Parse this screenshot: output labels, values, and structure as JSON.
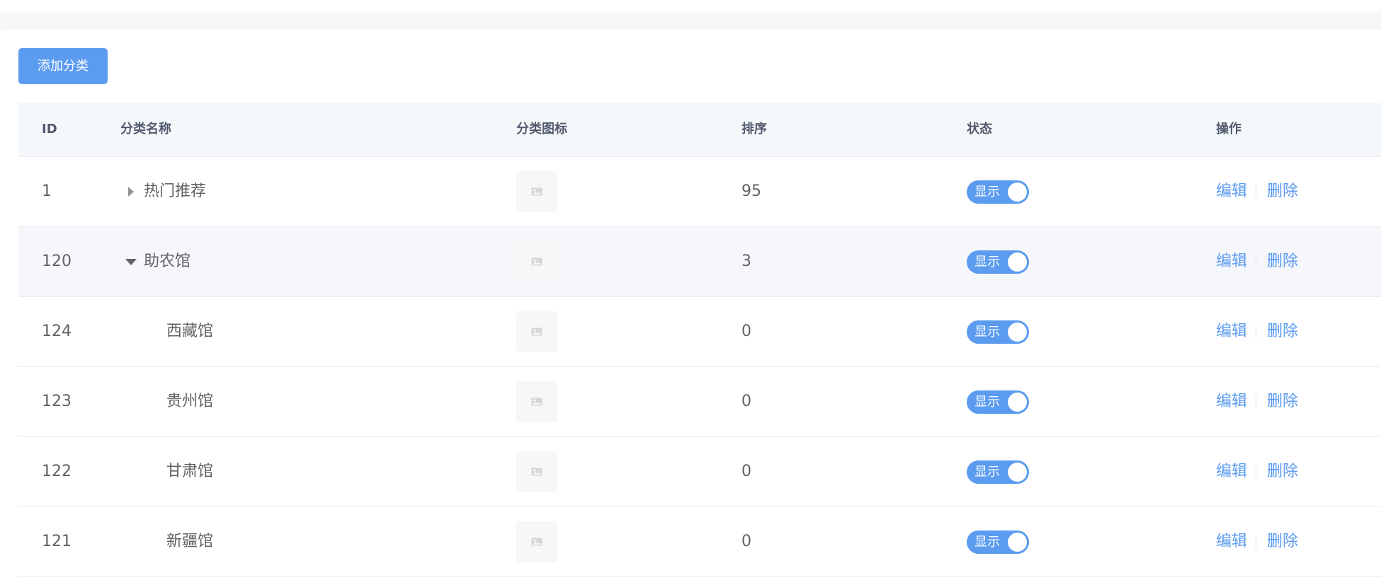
{
  "toolbar": {
    "add_label": "添加分类"
  },
  "table": {
    "columns": {
      "id": "ID",
      "name": "分类名称",
      "icon": "分类图标",
      "sort": "排序",
      "status": "状态",
      "ops": "操作"
    },
    "rows": [
      {
        "id": "1",
        "name": "热门推荐",
        "sort": "95",
        "status": "显示",
        "edit": "编辑",
        "delete": "删除",
        "icon": "image-placeholder-icon"
      },
      {
        "id": "120",
        "name": "助农馆",
        "sort": "3",
        "status": "显示",
        "edit": "编辑",
        "delete": "删除",
        "icon": "image-placeholder-icon"
      },
      {
        "id": "124",
        "name": "西藏馆",
        "sort": "0",
        "status": "显示",
        "edit": "编辑",
        "delete": "删除",
        "icon": "image-placeholder-icon"
      },
      {
        "id": "123",
        "name": "贵州馆",
        "sort": "0",
        "status": "显示",
        "edit": "编辑",
        "delete": "删除",
        "icon": "image-placeholder-icon"
      },
      {
        "id": "122",
        "name": "甘肃馆",
        "sort": "0",
        "status": "显示",
        "edit": "编辑",
        "delete": "删除",
        "icon": "image-placeholder-icon"
      },
      {
        "id": "121",
        "name": "新疆馆",
        "sort": "0",
        "status": "显示",
        "edit": "编辑",
        "delete": "删除",
        "icon": "image-placeholder-icon"
      }
    ]
  },
  "colors": {
    "accent": "#5b9bf0",
    "header_bg": "#f5f8fb",
    "row_highlight": "#f5f7fa"
  }
}
